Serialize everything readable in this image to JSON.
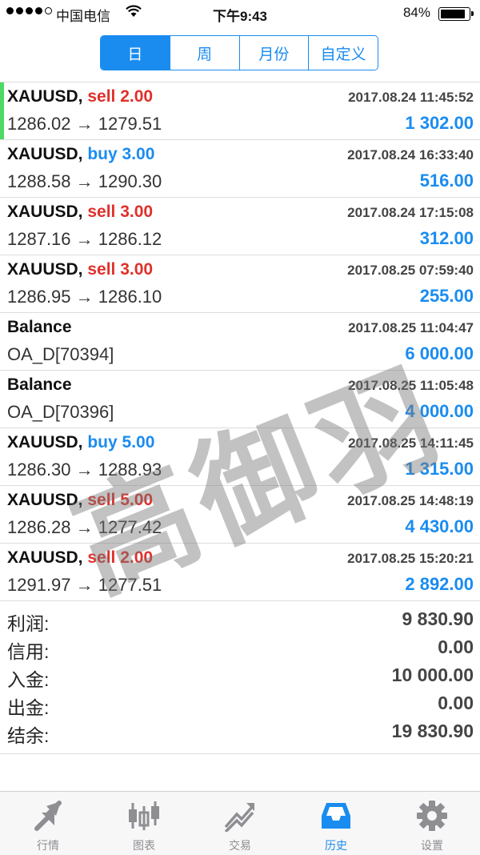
{
  "status_bar": {
    "carrier": "中国电信",
    "time": "下午9:43",
    "battery": "84%",
    "battery_level": 0.84
  },
  "segments": [
    {
      "label": "日",
      "active": true
    },
    {
      "label": "周",
      "active": false
    },
    {
      "label": "月份",
      "active": false
    },
    {
      "label": "自定义",
      "active": false
    }
  ],
  "entries": [
    {
      "symbol": "XAUUSD,",
      "side": "sell",
      "size": "sell 2.00",
      "date": "2017.08.24 11:45:52",
      "prices": "1286.02 → 1279.51",
      "profit": "1 302.00"
    },
    {
      "symbol": "XAUUSD,",
      "side": "buy",
      "size": "buy 3.00",
      "date": "2017.08.24 16:33:40",
      "prices": "1288.58 → 1290.30",
      "profit": "516.00"
    },
    {
      "symbol": "XAUUSD,",
      "side": "sell",
      "size": "sell 3.00",
      "date": "2017.08.24 17:15:08",
      "prices": "1287.16 → 1286.12",
      "profit": "312.00"
    },
    {
      "symbol": "XAUUSD,",
      "side": "sell",
      "size": "sell 3.00",
      "date": "2017.08.25 07:59:40",
      "prices": "1286.95 → 1286.10",
      "profit": "255.00"
    },
    {
      "symbol": "Balance",
      "side": "",
      "size": "",
      "date": "2017.08.25 11:04:47",
      "prices": "OA_D[70394]",
      "profit": "6 000.00"
    },
    {
      "symbol": "Balance",
      "side": "",
      "size": "",
      "date": "2017.08.25 11:05:48",
      "prices": "OA_D[70396]",
      "profit": "4 000.00"
    },
    {
      "symbol": "XAUUSD,",
      "side": "buy",
      "size": "buy 5.00",
      "date": "2017.08.25 14:11:45",
      "prices": "1286.30 → 1288.93",
      "profit": "1 315.00"
    },
    {
      "symbol": "XAUUSD,",
      "side": "sell",
      "size": "sell 5.00",
      "date": "2017.08.25 14:48:19",
      "prices": "1286.28 → 1277.42",
      "profit": "4 430.00"
    },
    {
      "symbol": "XAUUSD,",
      "side": "sell",
      "size": "sell 2.00",
      "date": "2017.08.25 15:20:21",
      "prices": "1291.97 → 1277.51",
      "profit": "2 892.00"
    }
  ],
  "summary": [
    {
      "label": "利润:",
      "value": "9 830.90"
    },
    {
      "label": "信用:",
      "value": "0.00"
    },
    {
      "label": "入金:",
      "value": "10 000.00"
    },
    {
      "label": "出金:",
      "value": "0.00"
    },
    {
      "label": "结余:",
      "value": "19 830.90"
    }
  ],
  "watermark": "高御羽",
  "tabs": [
    {
      "label": "行情",
      "icon": "quotes-icon",
      "active": false
    },
    {
      "label": "图表",
      "icon": "chart-icon",
      "active": false
    },
    {
      "label": "交易",
      "icon": "trade-icon",
      "active": false
    },
    {
      "label": "历史",
      "icon": "history-icon",
      "active": true
    },
    {
      "label": "设置",
      "icon": "settings-icon",
      "active": false
    }
  ],
  "colors": {
    "accent": "#1a8cf0",
    "sell": "#e0302b",
    "marker": "#4cd964"
  }
}
